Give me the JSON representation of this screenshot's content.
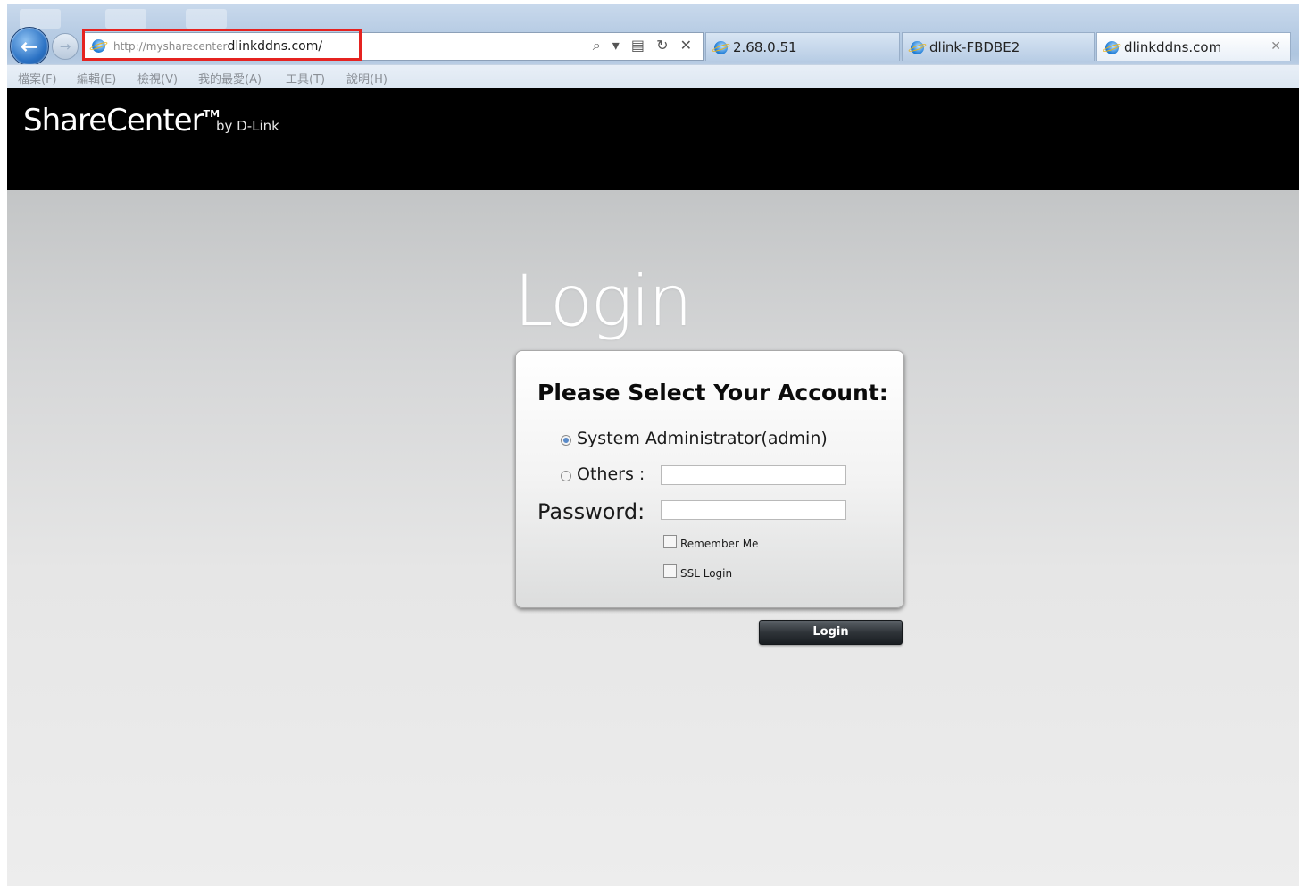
{
  "browser": {
    "url_prefix": "http://mysharecenter",
    "url_domain": "dlinkddns.com/",
    "tools_icons": "⌕ ▾ ▤ ↻ ✕",
    "tabs": [
      {
        "label": "2.68.0.51"
      },
      {
        "label": "dlink-FBDBE2"
      },
      {
        "label": "dlinkddns.com"
      }
    ],
    "menu": [
      "檔案(F)",
      "編輯(E)",
      "檢視(V)",
      "我的最愛(A)",
      "工具(T)",
      "說明(H)"
    ],
    "highlight_color": "#e52320"
  },
  "header": {
    "brand": "ShareCenter",
    "tm": "TM",
    "by": "by D-Link"
  },
  "login": {
    "title": "Login",
    "heading": "Please Select Your Account:",
    "option_admin": "System Administrator(admin)",
    "option_admin_selected": true,
    "option_others": "Others :",
    "password_label": "Password:",
    "others_value": "",
    "password_value": "",
    "remember_me": "Remember Me",
    "ssl_login": "SSL Login",
    "button": "Login"
  }
}
